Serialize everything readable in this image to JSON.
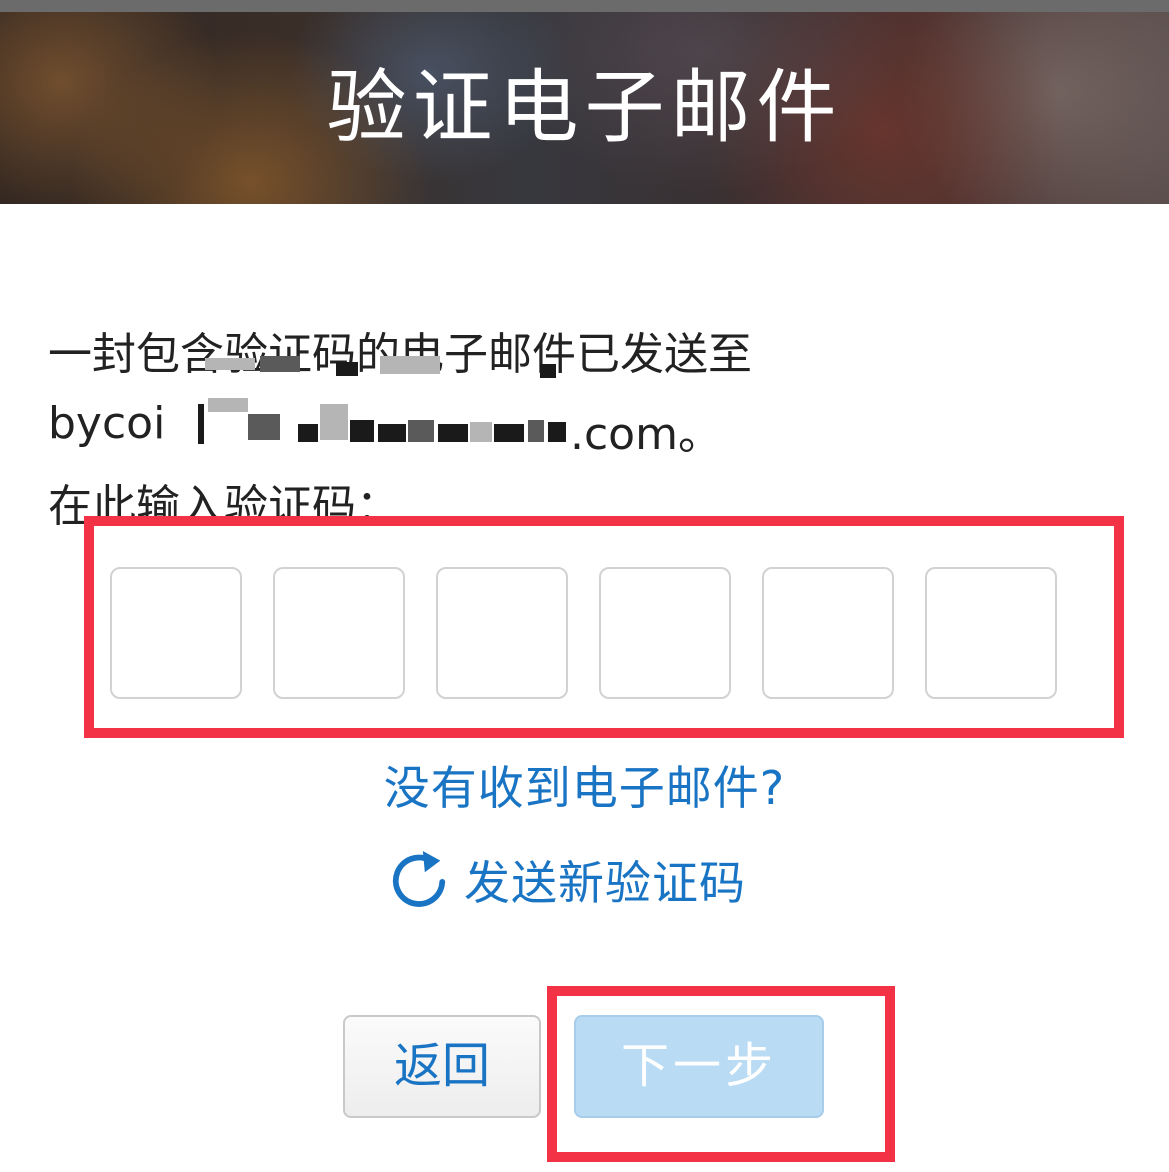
{
  "header": {
    "title": "验证电子邮件"
  },
  "message": {
    "line1": "一封包含验证码的电子邮件已发送至",
    "email_prefix": "bycoi",
    "email_suffix": ".com。",
    "line3": "在此输入验证码："
  },
  "code_inputs": [
    "",
    "",
    "",
    "",
    "",
    ""
  ],
  "links": {
    "no_email": "没有收到电子邮件?",
    "resend": "发送新验证码",
    "resend_icon": "refresh-icon"
  },
  "buttons": {
    "back": "返回",
    "next": "下一步",
    "next_enabled": false
  },
  "colors": {
    "link": "#1a74c4",
    "highlight": "#f43246",
    "next_disabled_bg": "#b9dbf4"
  }
}
